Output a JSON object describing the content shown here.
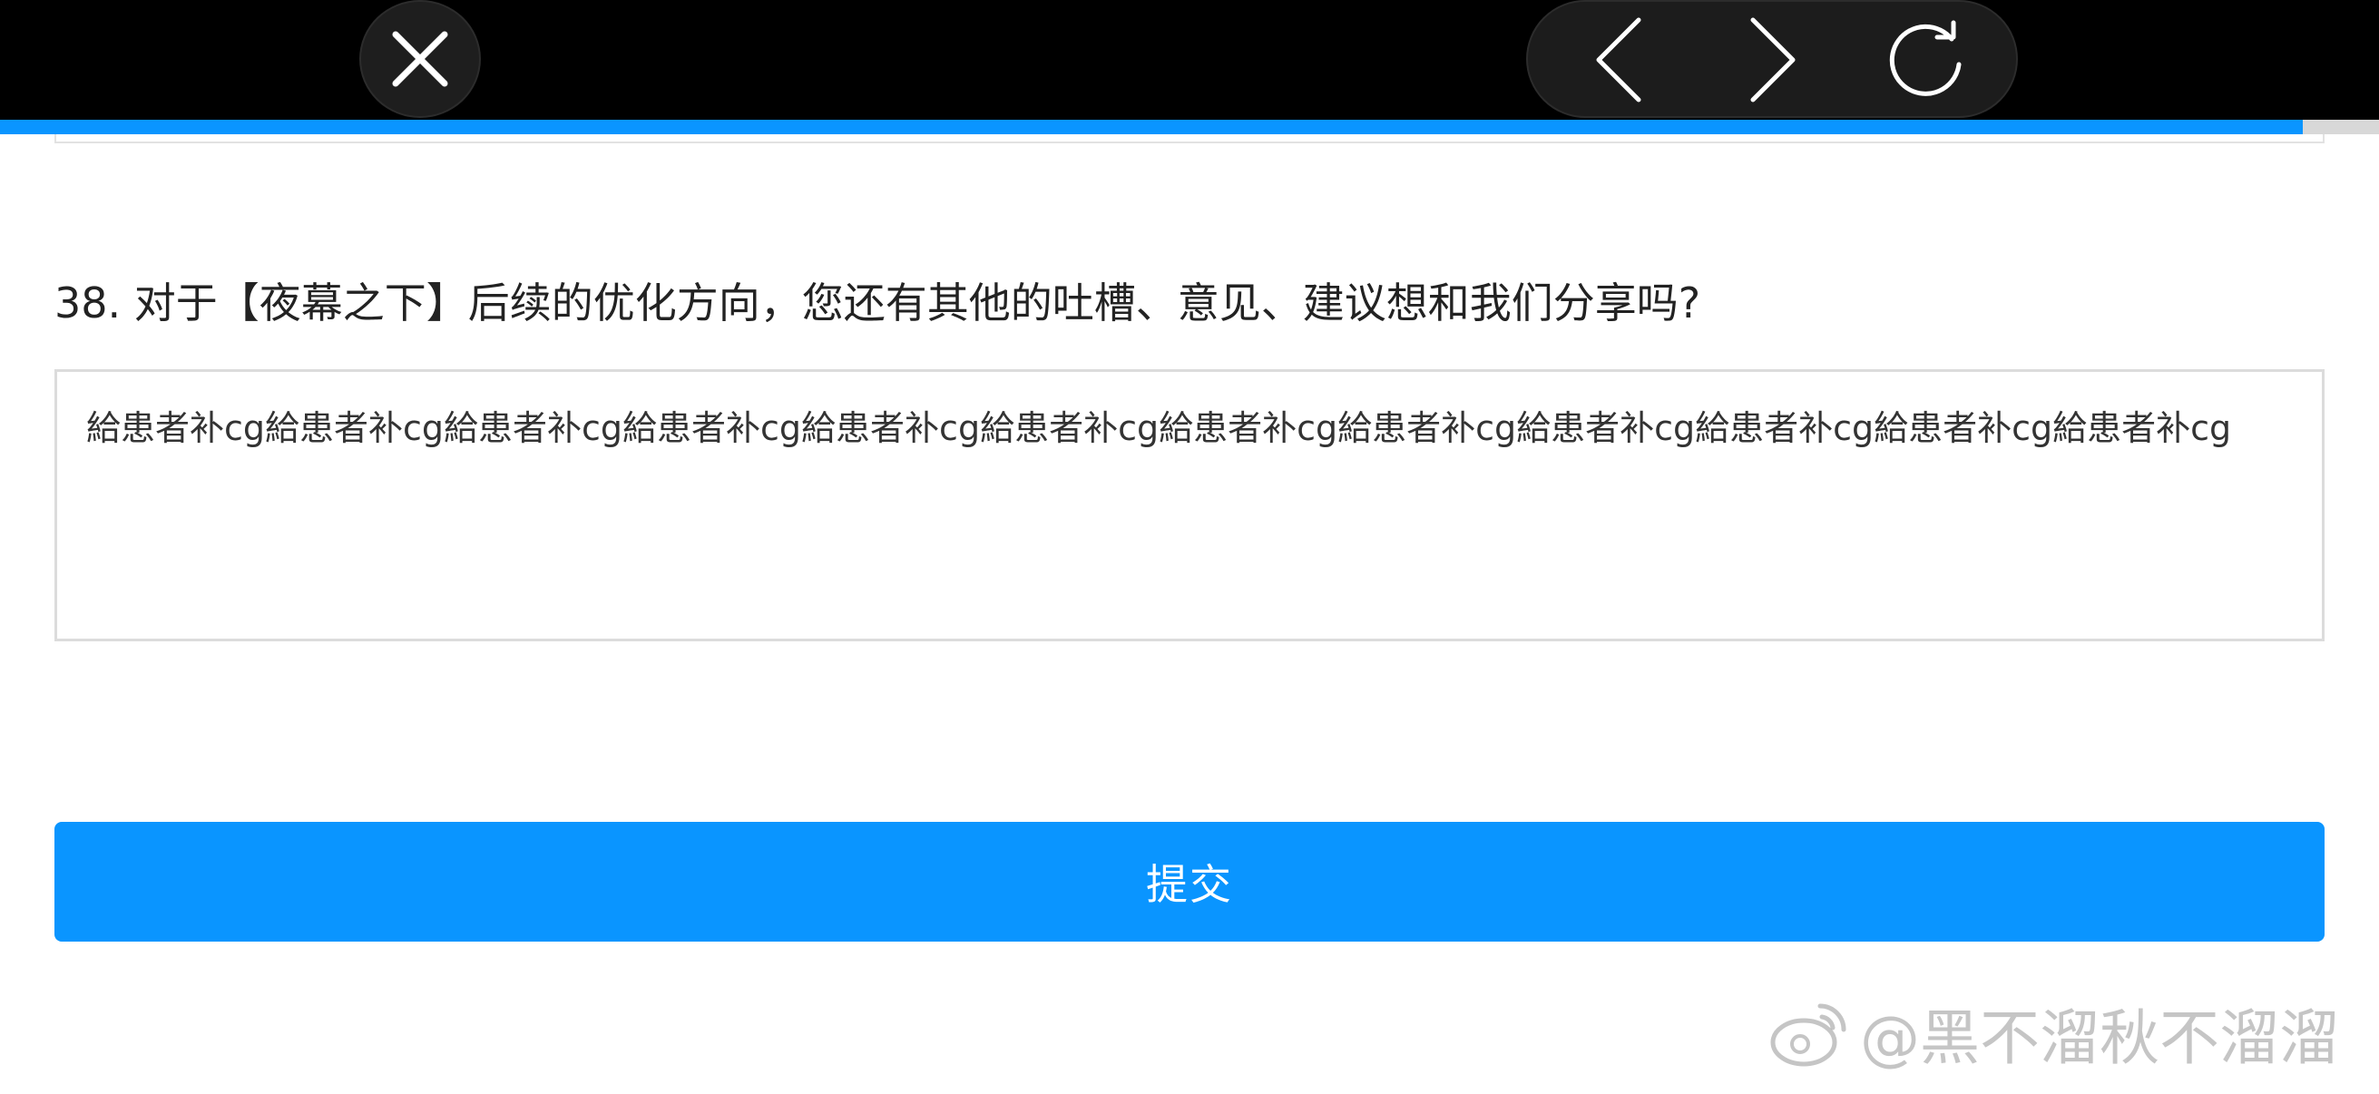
{
  "toolbar": {
    "close_icon": "close-icon",
    "back_icon": "chevron-left-icon",
    "forward_icon": "chevron-right-icon",
    "reload_icon": "reload-icon"
  },
  "progress": {
    "fraction": 0.968,
    "color": "#0a95ff"
  },
  "question": {
    "title": "38. 对于【夜幕之下】后续的优化方向，您还有其他的吐槽、意见、建议想和我们分享吗?",
    "answer_value": "給患者补cg給患者补cg給患者补cg給患者补cg給患者补cg給患者补cg給患者补cg給患者补cg給患者补cg給患者补cg給患者补cg給患者补cg"
  },
  "submit": {
    "label": "提交",
    "color": "#0a95ff"
  },
  "watermark": {
    "text": "@黑不溜秋不溜溜",
    "logo_icon": "weibo-logo-icon"
  }
}
